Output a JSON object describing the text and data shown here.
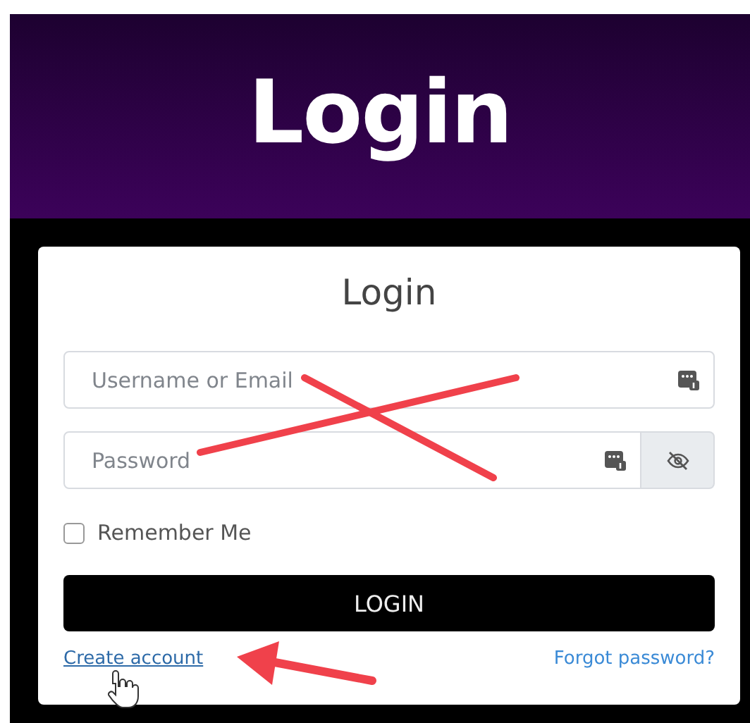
{
  "header": {
    "title": "Login"
  },
  "card": {
    "title": "Login",
    "fields": [
      {
        "kind": "text",
        "placeholder": "Username or Email"
      },
      {
        "kind": "password",
        "placeholder": "Password"
      }
    ],
    "remember": {
      "label": "Remember Me",
      "checked": false
    },
    "submit": "LOGIN",
    "links": [
      {
        "label": "Create account",
        "hovered": true
      },
      {
        "label": "Forgot password?",
        "hovered": false
      }
    ]
  }
}
